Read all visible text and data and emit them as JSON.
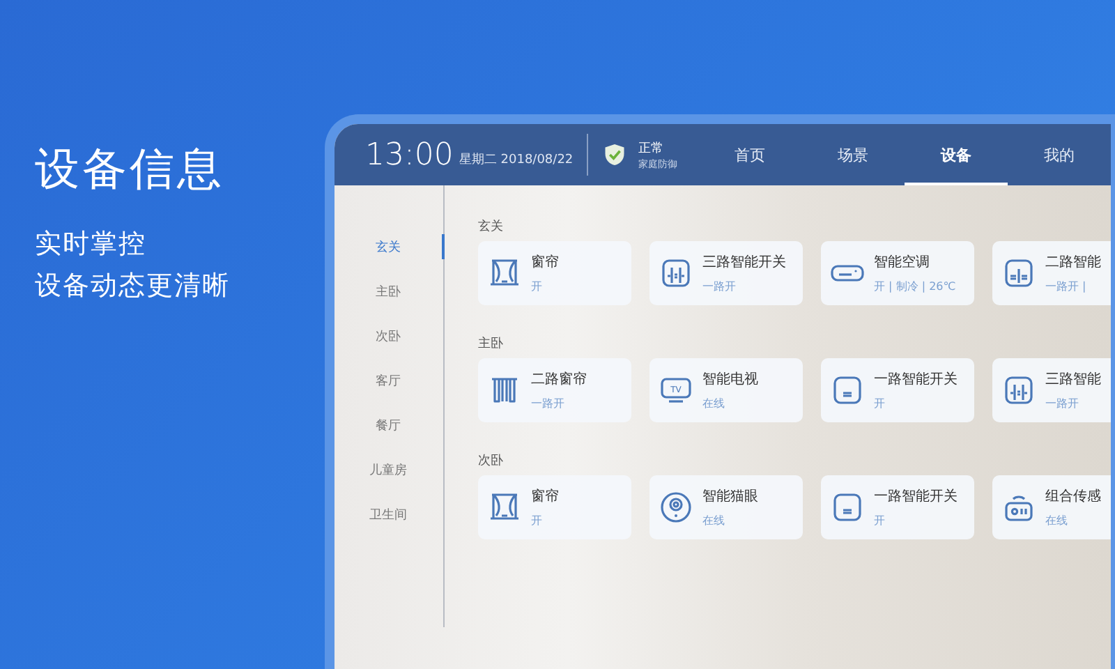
{
  "promo": {
    "headline": "设备信息",
    "lines": [
      "实时掌控",
      "设备动态更清晰"
    ]
  },
  "header": {
    "time": "13:00",
    "date": "星期二 2018/08/22",
    "security": {
      "status": "正常",
      "label": "家庭防御"
    },
    "tabs": [
      {
        "label": "首页",
        "selected": false
      },
      {
        "label": "场景",
        "selected": false
      },
      {
        "label": "设备",
        "selected": true
      },
      {
        "label": "我的",
        "selected": false
      }
    ]
  },
  "rooms": [
    {
      "label": "玄关",
      "selected": true
    },
    {
      "label": "主卧",
      "selected": false
    },
    {
      "label": "次卧",
      "selected": false
    },
    {
      "label": "客厅",
      "selected": false
    },
    {
      "label": "餐厅",
      "selected": false
    },
    {
      "label": "儿童房",
      "selected": false
    },
    {
      "label": "卫生间",
      "selected": false
    }
  ],
  "sections": [
    {
      "title": "玄关",
      "devices": [
        {
          "kind": "curtain",
          "name": "窗帘",
          "status": "开"
        },
        {
          "kind": "switch3",
          "name": "三路智能开关",
          "status": "一路开"
        },
        {
          "kind": "ac",
          "name": "智能空调",
          "status": "开 | 制冷 | 26℃"
        },
        {
          "kind": "switch2",
          "name": "二路智能",
          "status": "一路开 |"
        }
      ]
    },
    {
      "title": "主卧",
      "devices": [
        {
          "kind": "curtain2",
          "name": "二路窗帘",
          "status": "一路开"
        },
        {
          "kind": "tv",
          "icon_text": "TV",
          "name": "智能电视",
          "status": "在线"
        },
        {
          "kind": "switch1",
          "name": "一路智能开关",
          "status": "开"
        },
        {
          "kind": "switch3",
          "name": "三路智能",
          "status": "一路开"
        }
      ]
    },
    {
      "title": "次卧",
      "devices": [
        {
          "kind": "curtain",
          "name": "窗帘",
          "status": "开"
        },
        {
          "kind": "peephole",
          "name": "智能猫眼",
          "status": "在线"
        },
        {
          "kind": "switch1",
          "name": "一路智能开关",
          "status": "开"
        },
        {
          "kind": "sensor",
          "name": "组合传感",
          "status": "在线"
        }
      ]
    }
  ]
}
